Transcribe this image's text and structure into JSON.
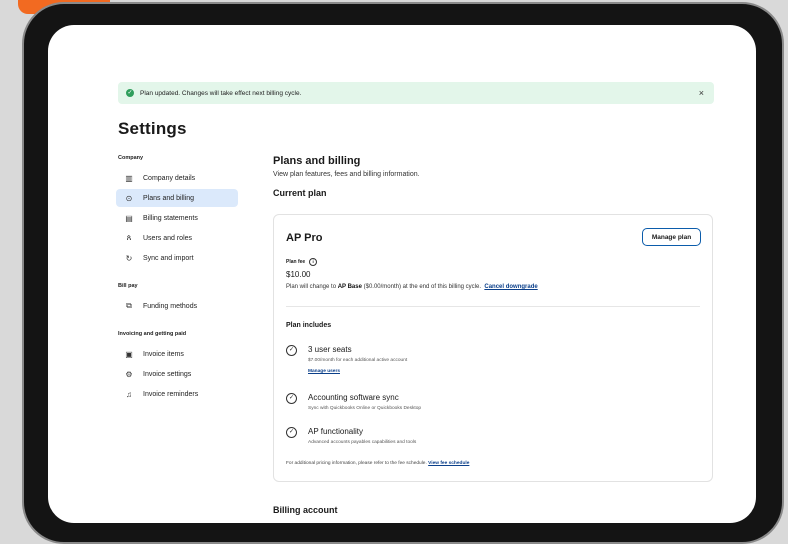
{
  "toast": {
    "message": "Plan updated. Changes will take effect next billing cycle.",
    "close_icon": "×"
  },
  "page_title": "Settings",
  "sidebar": {
    "company_label": "Company",
    "company_items": [
      {
        "label": "Company details",
        "icon": "building-icon"
      },
      {
        "label": "Plans and billing",
        "icon": "plan-icon",
        "active": true
      },
      {
        "label": "Billing statements",
        "icon": "statement-icon"
      },
      {
        "label": "Users and roles",
        "icon": "users-icon"
      },
      {
        "label": "Sync and import",
        "icon": "sync-icon"
      }
    ],
    "billpay_label": "Bill pay",
    "billpay_items": [
      {
        "label": "Funding methods",
        "icon": "wallet-icon"
      }
    ],
    "invoicing_label": "Invoicing and getting paid",
    "invoicing_items": [
      {
        "label": "Invoice items",
        "icon": "invoice-icon"
      },
      {
        "label": "Invoice settings",
        "icon": "gear-icon"
      },
      {
        "label": "Invoice reminders",
        "icon": "bell-icon"
      }
    ]
  },
  "main": {
    "title": "Plans and billing",
    "subtitle": "View plan features, fees and billing information.",
    "current_plan_heading": "Current plan",
    "billing_account_heading": "Billing account"
  },
  "plan": {
    "name": "AP Pro",
    "manage_button": "Manage plan",
    "fee_label": "Plan fee",
    "fee_value": "$10.00",
    "change_prefix": "Plan will change to",
    "change_plan": "AP Base",
    "change_suffix": "($0.00/month) at the end of this billing cycle.",
    "cancel_link": "Cancel downgrade",
    "includes_heading": "Plan includes",
    "features": [
      {
        "title": "3 user seats",
        "desc": "$7.00/month for each additional active account",
        "link": "Manage users"
      },
      {
        "title": "Accounting software sync",
        "desc": "Sync with Quickbooks Online or Quickbooks Desktop"
      },
      {
        "title": "AP functionality",
        "desc": "Advanced accounts payables capabilities and tools"
      }
    ],
    "footer_text": "For additional pricing information, please refer to the fee schedule.",
    "footer_link": "View fee schedule"
  },
  "colors": {
    "accent": "#0b5cab",
    "active_bg": "#dbe9fb",
    "toast_bg": "#e3f6ea",
    "success": "#2f9e5c",
    "brand_orange": "#f26a21"
  }
}
